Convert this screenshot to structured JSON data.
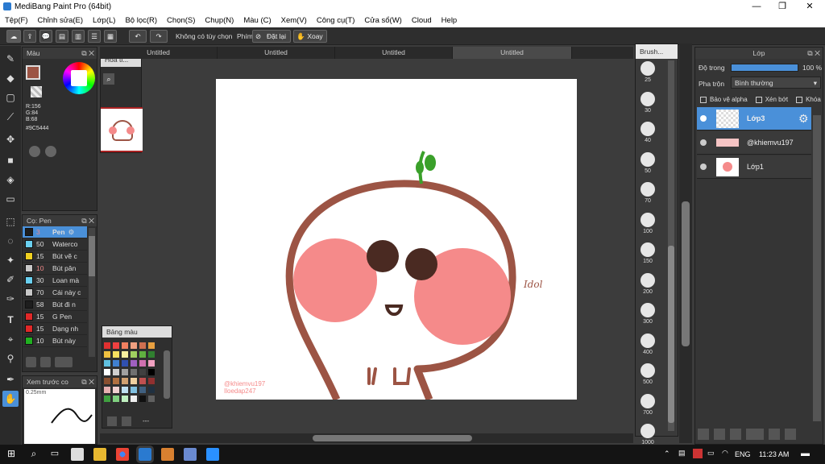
{
  "window": {
    "title": "MediBang Paint Pro (64bit)",
    "minimize": "—",
    "maximize": "❐",
    "close": "✕"
  },
  "menu": [
    "Tệp(F)",
    "Chỉnh sửa(E)",
    "Lớp(L)",
    "Bộ lọc(R)",
    "Chọn(S)",
    "Chụp(N)",
    "Màu (C)",
    "Xem(V)",
    "Công cụ(T)",
    "Cửa sổ(W)",
    "Cloud",
    "Help"
  ],
  "toolbar": {
    "no_option": "Không có tùy chọn",
    "key": "Phím",
    "reset": "Đặt lại",
    "rotate": "Xoay"
  },
  "color_panel": {
    "title": "Màu",
    "r": "R:156",
    "g": "G:84",
    "b": "B:68",
    "hex": "#9C5444",
    "primary": "#9c5444"
  },
  "navigator": {
    "title": "Hoa ti..."
  },
  "brush_panel": {
    "title": "Cọ: Pen",
    "items": [
      {
        "size": "3",
        "name": "Pen",
        "color": "#1e1e1e"
      },
      {
        "size": "50",
        "name": "Waterco",
        "color": "#6ad0f0"
      },
      {
        "size": "15",
        "name": "Bút vẽ c",
        "color": "#f0d020"
      },
      {
        "size": "10",
        "name": "Bút pân",
        "color": "#c8c8c8"
      },
      {
        "size": "30",
        "name": "Loan mà",
        "color": "#6ad0f0"
      },
      {
        "size": "70",
        "name": "Cái này c",
        "color": "#c8c8c8"
      },
      {
        "size": "58",
        "name": "Bút đi n",
        "color": "#1e1e1e"
      },
      {
        "size": "15",
        "name": "G Pen",
        "color": "#e02828"
      },
      {
        "size": "15",
        "name": "Dạng nh",
        "color": "#e02828"
      },
      {
        "size": "10",
        "name": "Bút này",
        "color": "#20b020"
      }
    ]
  },
  "preview": {
    "title": "Xem trước co",
    "size": "0.25mm"
  },
  "palette": {
    "title": "Bảng màu",
    "more": "---"
  },
  "tabs": [
    "Untitled",
    "Untitled",
    "Untitled",
    "Untitled"
  ],
  "canvas": {
    "signature": "Idol",
    "watermark1": "@khiemvu197",
    "watermark2": "Iloedap247"
  },
  "brush_sizes": {
    "title": "Brush...",
    "sizes": [
      "25",
      "30",
      "40",
      "50",
      "70",
      "100",
      "150",
      "200",
      "300",
      "400",
      "500",
      "700",
      "1000"
    ]
  },
  "layers": {
    "title": "Lớp",
    "opacity_label": "Độ trong",
    "opacity_value": "100 %",
    "blend_label": "Pha trộn",
    "blend_value": "Bình thường",
    "protect_alpha": "Bảo vệ alpha",
    "clipping": "Xén bớt",
    "lock": "Khóa",
    "items": [
      {
        "name": "Lớp3"
      },
      {
        "name": "@khiemvu197"
      },
      {
        "name": "Lớp1"
      }
    ]
  },
  "taskbar": {
    "lang": "ENG",
    "time": "11:23 AM"
  }
}
